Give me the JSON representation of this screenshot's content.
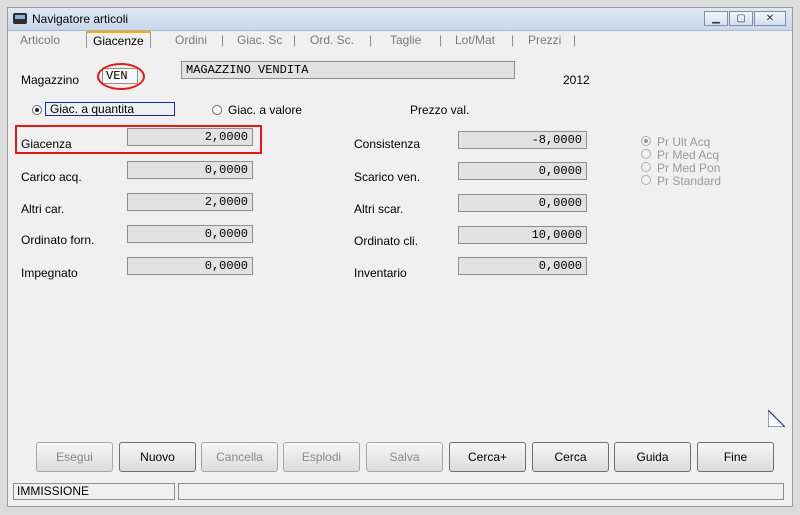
{
  "window": {
    "title": "Navigatore articoli"
  },
  "tabs": [
    {
      "label": "Articolo",
      "active": false
    },
    {
      "label": "Giacenze",
      "active": true
    },
    {
      "label": "Ordini",
      "active": false
    },
    {
      "label": "Giac. Sc",
      "active": false
    },
    {
      "label": "Ord. Sc.",
      "active": false
    },
    {
      "label": "Taglie",
      "active": false
    },
    {
      "label": "Lot/Mat",
      "active": false
    },
    {
      "label": "Prezzi",
      "active": false
    }
  ],
  "tab_separator": "|",
  "header": {
    "magazzino_label": "Magazzino",
    "magazzino_code": "VEN",
    "magazzino_name": "MAGAZZINO VENDITA",
    "year": "2012"
  },
  "modes": {
    "quantity_label": "Giac. a quantita",
    "value_label": "Giac. a valore",
    "selected": "quantity",
    "price_label": "Prezzo val."
  },
  "left_fields": [
    {
      "label": "Giacenza",
      "value": "2,0000"
    },
    {
      "label": "Carico acq.",
      "value": "0,0000"
    },
    {
      "label": "Altri car.",
      "value": "2,0000"
    },
    {
      "label": "Ordinato forn.",
      "value": "0,0000"
    },
    {
      "label": "Impegnato",
      "value": "0,0000"
    }
  ],
  "right_fields": [
    {
      "label": "Consistenza",
      "value": "-8,0000"
    },
    {
      "label": "Scarico ven.",
      "value": "0,0000"
    },
    {
      "label": "Altri scar.",
      "value": "0,0000"
    },
    {
      "label": "Ordinato cli.",
      "value": "10,0000"
    },
    {
      "label": "Inventario",
      "value": "0,0000"
    }
  ],
  "price_options": [
    {
      "label": "Pr Ult Acq",
      "selected": true
    },
    {
      "label": "Pr Med Acq",
      "selected": false
    },
    {
      "label": "Pr Med Pon",
      "selected": false
    },
    {
      "label": "Pr Standard",
      "selected": false
    }
  ],
  "buttons": [
    {
      "label": "Esegui",
      "enabled": false
    },
    {
      "label": "Nuovo",
      "enabled": true
    },
    {
      "label": "Cancella",
      "enabled": false
    },
    {
      "label": "Esplodi",
      "enabled": false
    },
    {
      "label": "Salva",
      "enabled": false
    },
    {
      "label": "Cerca+",
      "enabled": true
    },
    {
      "label": "Cerca",
      "enabled": true
    },
    {
      "label": "Guida",
      "enabled": true
    },
    {
      "label": "Fine",
      "enabled": true
    }
  ],
  "status": {
    "mode": "IMMISSIONE",
    "message": ""
  },
  "highlight_color": "#e01b1b"
}
